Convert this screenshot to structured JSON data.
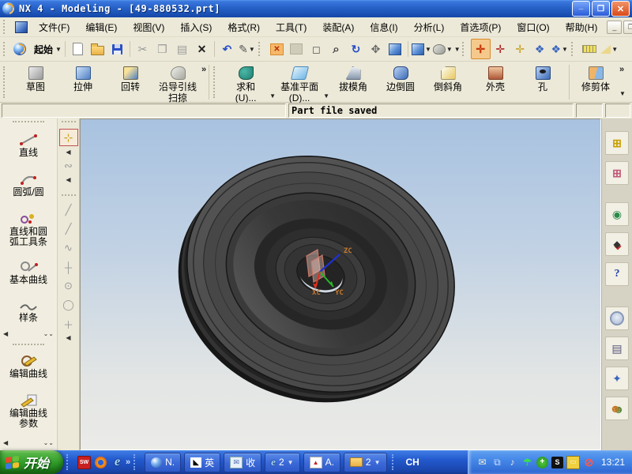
{
  "window": {
    "title": "NX 4 - Modeling - [49-880532.prt]"
  },
  "menu": {
    "items": [
      "文件(F)",
      "编辑(E)",
      "视图(V)",
      "插入(S)",
      "格式(R)",
      "工具(T)",
      "装配(A)",
      "信息(I)",
      "分析(L)",
      "首选项(P)",
      "窗口(O)",
      "帮助(H)"
    ]
  },
  "toolbar_standard": {
    "start_label": "起始"
  },
  "toolbar_features": {
    "buttons": [
      {
        "label": "草图"
      },
      {
        "label": "拉伸"
      },
      {
        "label": "回转"
      },
      {
        "label": "沿导引线",
        "label2": "扫掠"
      },
      {
        "label": "求和",
        "label2": "(U)..."
      },
      {
        "label": "基准平面",
        "label2": "(D)..."
      },
      {
        "label": "拔模角"
      },
      {
        "label": "边倒圆"
      },
      {
        "label": "倒斜角"
      },
      {
        "label": "外壳"
      },
      {
        "label": "孔"
      },
      {
        "label": "修剪体"
      }
    ]
  },
  "status_bar": {
    "message": "Part file saved"
  },
  "left_toolbar": {
    "curve_buttons": [
      {
        "label": "直线"
      },
      {
        "label": "圆弧/圆"
      },
      {
        "label": "直线和圆",
        "label2": "弧工具条"
      },
      {
        "label": "基本曲线"
      },
      {
        "label": "样条"
      }
    ],
    "edit_buttons": [
      {
        "label": "编辑曲线"
      },
      {
        "label": "编辑曲线",
        "label2": "参数"
      }
    ]
  },
  "viewport": {
    "axes": {
      "x": "XC",
      "y": "YC",
      "z": "ZC"
    },
    "colors": {
      "x_axis": "#e03020",
      "y_axis": "#28b828",
      "z_axis": "#2030d0",
      "axis_label": "#c87828",
      "background_top": "#a8c2e0",
      "background_bottom": "#ebebe8",
      "model": "#4a4a4a",
      "datum_plane": "#d89080"
    }
  },
  "resource_bar": {
    "icons": [
      "assembly-navigator",
      "part-navigator",
      "web-browser",
      "training",
      "help",
      "history",
      "palettes",
      "system",
      "roles"
    ]
  },
  "taskbar": {
    "start_label": "开始",
    "quick_launch": {
      "solidworks_label": "SW",
      "ie_label": "e"
    },
    "buttons": [
      {
        "label": "N."
      },
      {
        "label": "英"
      },
      {
        "label": "收"
      },
      {
        "label": "2"
      },
      {
        "label": "A."
      },
      {
        "label": "2"
      }
    ],
    "language": "CH",
    "clock": "13:21"
  },
  "icons": {
    "nx-logo": "swirl-sphere",
    "new-file": "❏ page",
    "open": "folder-shape",
    "save": "floppy-shape",
    "cut": "✂",
    "copy": "❐",
    "paste": "▤",
    "delete": "✕",
    "undo": "↶",
    "info": "✎",
    "fit-view": "orange ▣ with ✕",
    "disabled-fill": "gray square",
    "zoom-window": "◻",
    "zoom": "⌕",
    "rotate-view": "↻",
    "pan": "✥",
    "perspective-view": "blue cube",
    "iso-view": "blue cube",
    "shaded-view": "gray blob",
    "wcs-display": "✛ axes",
    "measure-distance": "yellow ruler",
    "measure-angle": "triangle",
    "chevron-more": "»",
    "dropdown": "▾",
    "collapse-left": "◀"
  }
}
